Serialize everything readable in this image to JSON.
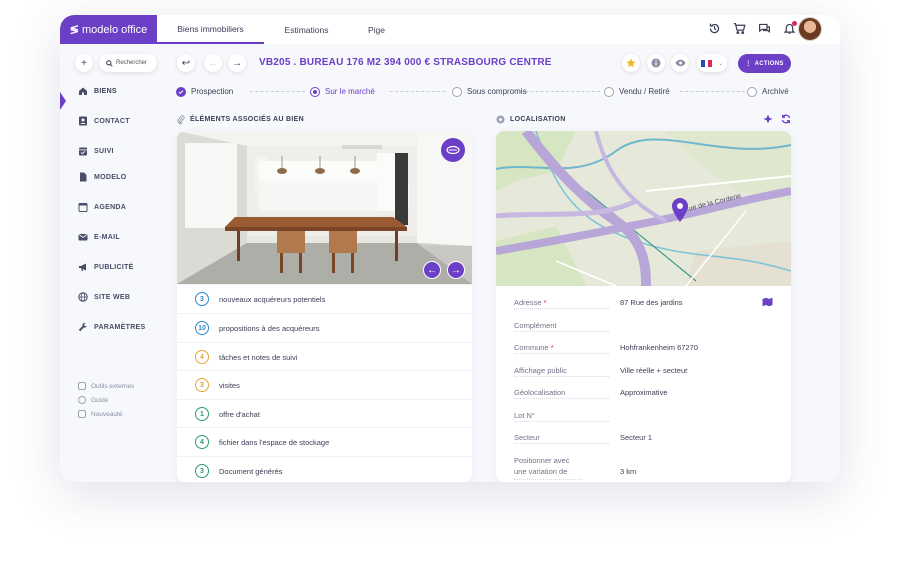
{
  "app": {
    "logo_text": "modelo office",
    "colors": {
      "accent": "#6b3fc6",
      "danger": "#e0245e",
      "text": "#3b3e57"
    }
  },
  "topnav": {
    "tabs": [
      {
        "label": "Biens immobiliers",
        "active": true
      },
      {
        "label": "Estimations",
        "active": false
      },
      {
        "label": "Pige",
        "active": false
      }
    ],
    "icons": [
      "history-icon",
      "cart-icon",
      "chat-icon",
      "bell-icon"
    ]
  },
  "toolbar": {
    "search_placeholder": "Rechercher",
    "property_title": "VB205 . BUREAU 176 M2 394 000 €  STRASBOURG CENTRE",
    "language_code": "",
    "actions_label": "ACTIONS"
  },
  "sidebar": {
    "items": [
      {
        "label": "BIENS",
        "icon": "home-icon",
        "active": true
      },
      {
        "label": "CONTACT",
        "icon": "contact-icon",
        "active": false
      },
      {
        "label": "SUIVI",
        "icon": "calendar-check-icon",
        "active": false
      },
      {
        "label": "MODELO",
        "icon": "document-icon",
        "active": false
      },
      {
        "label": "AGENDA",
        "icon": "calendar-icon",
        "active": false
      },
      {
        "label": "E-MAIL",
        "icon": "mail-icon",
        "active": false
      },
      {
        "label": "PUBLICITÉ",
        "icon": "megaphone-icon",
        "active": false
      },
      {
        "label": "SITE WEB",
        "icon": "globe-icon",
        "active": false
      },
      {
        "label": "PARAMÈTRES",
        "icon": "wrench-icon",
        "active": false
      }
    ],
    "footer_links": [
      {
        "label": "Outils externes"
      },
      {
        "label": "Guide"
      },
      {
        "label": "Nouveauté"
      }
    ]
  },
  "status_steps": [
    {
      "label": "Prospection",
      "state": "done"
    },
    {
      "label": "Sur le marché",
      "state": "current"
    },
    {
      "label": "Sous compromis",
      "state": "todo"
    },
    {
      "label": "Vendu / Retiré",
      "state": "todo"
    },
    {
      "label": "Archivé",
      "state": "todo"
    }
  ],
  "associated": {
    "section_title": "ÉLÉMENTS ASSOCIÉS AU BIEN",
    "items": [
      {
        "count": "3",
        "label": "nouveaux acquéreurs potentiels",
        "color": "#2f86c9"
      },
      {
        "count": "10",
        "label": "propositions à des acquéreurs",
        "color": "#2f86c9"
      },
      {
        "count": "4",
        "label": "tâches et notes de suivi",
        "color": "#e8a33a"
      },
      {
        "count": "3",
        "label": "visites",
        "color": "#e8a33a"
      },
      {
        "count": "1",
        "label": "offre d'achat",
        "color": "#2a9a6a"
      },
      {
        "count": "4",
        "label": "fichier dans l'espace de stockage",
        "color": "#2a9a6a"
      },
      {
        "count": "3",
        "label": "Document générés",
        "color": "#2a9a6a"
      }
    ]
  },
  "location": {
    "section_title": "LOCALISATION",
    "map_street_label": "Rue de la Corderie",
    "fields": [
      {
        "label": "Adresse",
        "required": true,
        "value": "87 Rue des jardins"
      },
      {
        "label": "Complément",
        "required": false,
        "value": ""
      },
      {
        "label": "Commune",
        "required": true,
        "value": "Hohfrankenheim 67270"
      },
      {
        "label": "Affichage public",
        "required": false,
        "value": "Ville réelle + secteur"
      },
      {
        "label": "Géolocalisation",
        "required": false,
        "value": "Approximative"
      },
      {
        "label": "Lot N°",
        "required": false,
        "value": ""
      },
      {
        "label": "Secteur",
        "required": false,
        "value": "Secteur 1"
      },
      {
        "label": "Positionner avec une variation de",
        "required": false,
        "value": "3 km"
      }
    ]
  }
}
